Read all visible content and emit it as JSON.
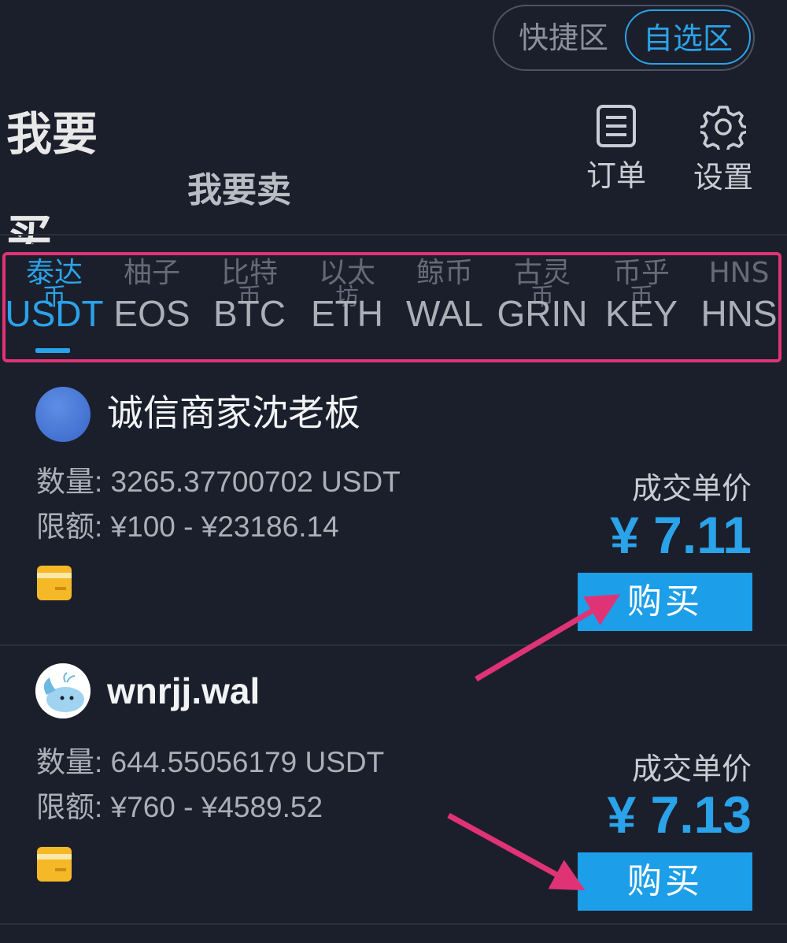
{
  "toggle": {
    "quick": "快捷区",
    "self_select": "自选区"
  },
  "actions": {
    "orders": "订单",
    "settings": "设置"
  },
  "side_clipped": {
    "line1": "我要",
    "line2": "买"
  },
  "sell_title": "我要卖",
  "coin_tabs": [
    {
      "cn": "泰达",
      "cn2": "币",
      "code": "USDT",
      "active": true
    },
    {
      "cn": "柚子",
      "cn2": "",
      "code": "EOS"
    },
    {
      "cn": "比特",
      "cn2": "币",
      "code": "BTC"
    },
    {
      "cn": "以太",
      "cn2": "坊",
      "code": "ETH"
    },
    {
      "cn": "鲸币",
      "cn2": "",
      "code": "WAL"
    },
    {
      "cn": "古灵",
      "cn2": "币",
      "code": "GRIN"
    },
    {
      "cn": "币乎",
      "cn2": "币",
      "code": "KEY"
    },
    {
      "cn": "HNS",
      "cn2": "",
      "code": "HNS"
    }
  ],
  "listings": [
    {
      "merchant": "诚信商家沈老板",
      "quantity": "数量: 3265.37700702 USDT",
      "limit": "限额: ¥100 - ¥23186.14",
      "price_label": "成交单价",
      "price": "¥ 7.11",
      "buy_label": "购买"
    },
    {
      "merchant": "wnrjj.wal",
      "quantity": "数量: 644.55056179 USDT",
      "limit": "限额: ¥760 - ¥4589.52",
      "price_label": "成交单价",
      "price": "¥ 7.13",
      "buy_label": "购买"
    }
  ],
  "colors": {
    "accent": "#2aa3ea",
    "highlight": "#e03376",
    "background": "#1b1f2b"
  }
}
